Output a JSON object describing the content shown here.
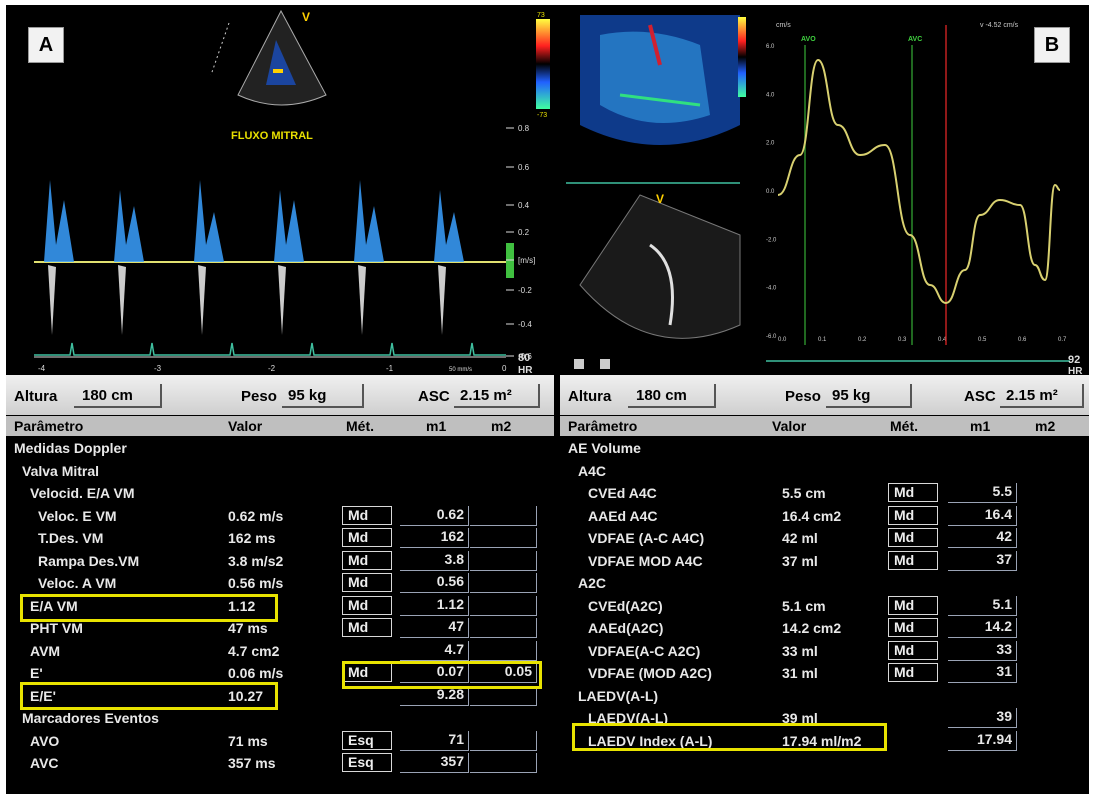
{
  "panel_a": {
    "label": "A",
    "marker": "V",
    "title": "FLUXO MITRAL",
    "scale_labels": [
      "0.8",
      "0.6",
      "0.4",
      "0.2",
      "[m/s]",
      "-0.2",
      "-0.4",
      "-0.6"
    ],
    "time_labels": [
      "-4",
      "-3",
      "-2",
      "-1",
      "0"
    ],
    "hr_value": "80",
    "hr_label": "HR",
    "sweep": "50 mm/s",
    "color_top": "73",
    "color_bottom": "-73"
  },
  "panel_b": {
    "label": "B",
    "marker": "V",
    "unit_label": "cm/s",
    "avo_label": "AVO",
    "avc_label": "AVC",
    "cursor_readout": "v -4.52 cm/s",
    "y_labels": [
      "6.0",
      "4.0",
      "2.0",
      "0.0",
      "-2.0",
      "-4.0",
      "-6.0"
    ],
    "x_labels": [
      "0.0",
      "0.1",
      "0.2",
      "0.3",
      "0.4",
      "0.5",
      "0.6",
      "0.7"
    ],
    "hr_value": "92",
    "hr_label": "HR"
  },
  "table_a": {
    "altura_label": "Altura",
    "altura_value": "180 cm",
    "peso_label": "Peso",
    "peso_value": "95 kg",
    "asc_label": "ASC",
    "asc_value": "2.15 m²",
    "col_param": "Parâmetro",
    "col_valor": "Valor",
    "col_met": "Mét.",
    "col_m1": "m1",
    "col_m2": "m2",
    "rows": [
      {
        "p": "Medidas Doppler",
        "v": "",
        "met": "",
        "m1": "",
        "m2": "",
        "level": 0
      },
      {
        "p": "Valva Mitral",
        "v": "",
        "met": "",
        "m1": "",
        "m2": "",
        "level": 1
      },
      {
        "p": "Velocid. E/A VM",
        "v": "",
        "met": "",
        "m1": "",
        "m2": "",
        "level": 2
      },
      {
        "p": "Veloc. E  VM",
        "v": "0.62 m/s",
        "met": "Md",
        "m1": "0.62",
        "m2": "",
        "level": 3
      },
      {
        "p": "T.Des. VM",
        "v": "162 ms",
        "met": "Md",
        "m1": "162",
        "m2": "",
        "level": 3
      },
      {
        "p": "Rampa Des.VM",
        "v": "3.8 m/s2",
        "met": "Md",
        "m1": "3.8",
        "m2": "",
        "level": 3
      },
      {
        "p": "Veloc. A  VM",
        "v": "0.56 m/s",
        "met": "Md",
        "m1": "0.56",
        "m2": "",
        "level": 3
      },
      {
        "p": "E/A VM",
        "v": "1.12",
        "met": "Md",
        "m1": "1.12",
        "m2": "",
        "level": 2
      },
      {
        "p": "PHT VM",
        "v": "47 ms",
        "met": "Md",
        "m1": "47",
        "m2": "",
        "level": 2
      },
      {
        "p": "AVM",
        "v": "4.7 cm2",
        "met": "",
        "m1": "4.7",
        "m2": "",
        "level": 2
      },
      {
        "p": "E'",
        "v": "0.06 m/s",
        "met": "Md",
        "m1": "0.07",
        "m2": "0.05",
        "level": 2
      },
      {
        "p": "E/E'",
        "v": "10.27",
        "met": "",
        "m1": "9.28",
        "m2": "",
        "level": 2
      },
      {
        "p": "Marcadores Eventos",
        "v": "",
        "met": "",
        "m1": "",
        "m2": "",
        "level": 1
      },
      {
        "p": "AVO",
        "v": "71 ms",
        "met": "Esq",
        "m1": "71",
        "m2": "",
        "level": 2
      },
      {
        "p": "AVC",
        "v": "357 ms",
        "met": "Esq",
        "m1": "357",
        "m2": "",
        "level": 2
      }
    ]
  },
  "table_b": {
    "altura_label": "Altura",
    "altura_value": "180 cm",
    "peso_label": "Peso",
    "peso_value": "95 kg",
    "asc_label": "ASC",
    "asc_value": "2.15 m²",
    "col_param": "Parâmetro",
    "col_valor": "Valor",
    "col_met": "Mét.",
    "col_m1": "m1",
    "col_m2": "m2",
    "rows": [
      {
        "p": "AE Volume",
        "v": "",
        "met": "",
        "m1": "",
        "level": 0
      },
      {
        "p": "A4C",
        "v": "",
        "met": "",
        "m1": "",
        "level": 1
      },
      {
        "p": "CVEd A4C",
        "v": "5.5 cm",
        "met": "Md",
        "m1": "5.5",
        "level": 2
      },
      {
        "p": "AAEd A4C",
        "v": "16.4 cm2",
        "met": "Md",
        "m1": "16.4",
        "level": 2
      },
      {
        "p": "VDFAE (A-C A4C)",
        "v": "42 ml",
        "met": "Md",
        "m1": "42",
        "level": 2
      },
      {
        "p": "VDFAE MOD A4C",
        "v": "37 ml",
        "met": "Md",
        "m1": "37",
        "level": 2
      },
      {
        "p": "A2C",
        "v": "",
        "met": "",
        "m1": "",
        "level": 1
      },
      {
        "p": "CVEd(A2C)",
        "v": "5.1 cm",
        "met": "Md",
        "m1": "5.1",
        "level": 2
      },
      {
        "p": "AAEd(A2C)",
        "v": "14.2 cm2",
        "met": "Md",
        "m1": "14.2",
        "level": 2
      },
      {
        "p": "VDFAE(A-C A2C)",
        "v": "33 ml",
        "met": "Md",
        "m1": "33",
        "level": 2
      },
      {
        "p": "VDFAE (MOD A2C)",
        "v": "31 ml",
        "met": "Md",
        "m1": "31",
        "level": 2
      },
      {
        "p": "LAEDV(A-L)",
        "v": "",
        "met": "",
        "m1": "",
        "level": 1
      },
      {
        "p": "LAEDV(A-L)",
        "v": "39 ml",
        "met": "",
        "m1": "39",
        "level": 2
      },
      {
        "p": "LAEDV Index (A-L)",
        "v": "17.94 ml/m2",
        "met": "",
        "m1": "17.94",
        "level": 2
      }
    ]
  },
  "colors": {
    "highlight": "#e8e300",
    "doppler": "#3aa0ff",
    "tdi": "#d8d070",
    "ecg": "#3fbf9f",
    "avo": "#2a8a2a",
    "cursor": "#c02020"
  }
}
